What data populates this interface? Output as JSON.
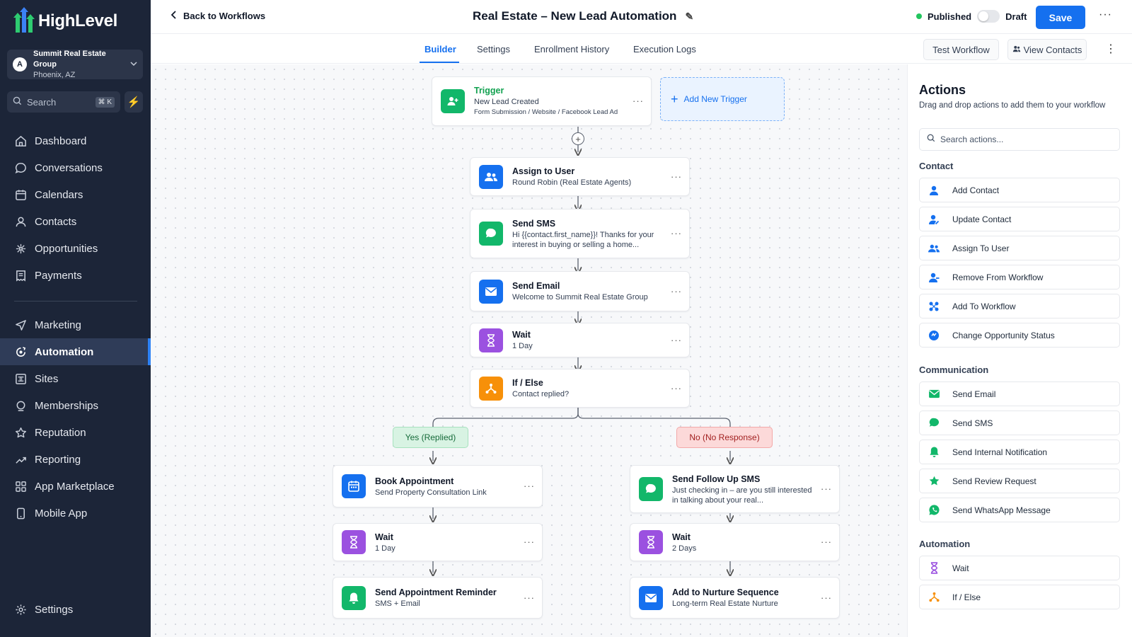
{
  "brand": {
    "name": "HighLevel",
    "colors": [
      "#2ecc71",
      "#3b82f6",
      "#f5b700"
    ]
  },
  "account": {
    "initial": "A",
    "name": "Summit Real Estate Group",
    "location": "Phoenix, AZ"
  },
  "sidebar_search": {
    "label": "Search",
    "shortcut": "⌘ K"
  },
  "nav": {
    "items": [
      {
        "label": "Dashboard",
        "icon": "dashboard-icon"
      },
      {
        "label": "Conversations",
        "icon": "chat-icon"
      },
      {
        "label": "Calendars",
        "icon": "calendar-icon"
      },
      {
        "label": "Contacts",
        "icon": "person-icon"
      },
      {
        "label": "Opportunities",
        "icon": "network-icon"
      },
      {
        "label": "Payments",
        "icon": "receipt-icon"
      }
    ],
    "items2": [
      {
        "label": "Marketing",
        "icon": "send-icon"
      },
      {
        "label": "Automation",
        "icon": "automation-icon",
        "active": true
      },
      {
        "label": "Sites",
        "icon": "sites-icon"
      },
      {
        "label": "Memberships",
        "icon": "membership-icon"
      },
      {
        "label": "Reputation",
        "icon": "star-icon"
      },
      {
        "label": "Reporting",
        "icon": "trend-icon"
      },
      {
        "label": "App Marketplace",
        "icon": "grid-icon"
      },
      {
        "label": "Mobile App",
        "icon": "phone-icon"
      }
    ],
    "settings": "Settings"
  },
  "header": {
    "back": "Back to Workflows",
    "title": "Real Estate – New Lead Automation",
    "published": "Published",
    "draft": "Draft",
    "save": "Save"
  },
  "tabs": [
    {
      "label": "Builder",
      "active": true
    },
    {
      "label": "Settings"
    },
    {
      "label": "Enrollment History"
    },
    {
      "label": "Execution Logs"
    }
  ],
  "tab_buttons": {
    "test": "Test Workflow",
    "view": "View Contacts"
  },
  "workflow": {
    "trigger": {
      "heading": "Trigger",
      "name": "New Lead Created",
      "sources": "Form Submission / Website / Facebook Lead Ad"
    },
    "add_trigger": "Add New Trigger",
    "steps": [
      {
        "title": "Assign to User",
        "sub": "Round Robin (Real Estate Agents)",
        "color": "#1570ef",
        "icon": "users-icon"
      },
      {
        "title": "Send SMS",
        "sub": "Hi {{contact.first_name}}! Thanks for your interest in buying or selling a home...",
        "color": "#12b76a",
        "icon": "sms-icon"
      },
      {
        "title": "Send Email",
        "sub": "Welcome to Summit Real Estate Group",
        "color": "#1570ef",
        "icon": "email-icon"
      },
      {
        "title": "Wait",
        "sub": "1 Day",
        "color": "#9b51e0",
        "icon": "hourglass-icon"
      },
      {
        "title": "If / Else",
        "sub": "Contact replied?",
        "color": "#f79009",
        "icon": "branch-icon"
      }
    ],
    "yes_label": "Yes (Replied)",
    "no_label": "No (No Response)",
    "yes_branch": [
      {
        "title": "Book Appointment",
        "sub": "Send Property Consultation Link",
        "color": "#1570ef",
        "icon": "calendar-icon"
      },
      {
        "title": "Wait",
        "sub": "1 Day",
        "color": "#9b51e0",
        "icon": "hourglass-icon"
      },
      {
        "title": "Send Appointment Reminder",
        "sub": "SMS + Email",
        "color": "#12b76a",
        "icon": "bell-icon"
      }
    ],
    "no_branch": [
      {
        "title": "Send Follow Up SMS",
        "sub": "Just checking in – are you still interested in talking about your real...",
        "color": "#12b76a",
        "icon": "sms-icon"
      },
      {
        "title": "Wait",
        "sub": "2 Days",
        "color": "#9b51e0",
        "icon": "hourglass-icon"
      },
      {
        "title": "Add to Nurture Sequence",
        "sub": "Long-term Real Estate Nurture",
        "color": "#1570ef",
        "icon": "email-icon"
      }
    ]
  },
  "panel": {
    "title": "Actions",
    "subtitle": "Drag and drop actions to add them to your workflow",
    "search_placeholder": "Search actions...",
    "sections": [
      {
        "label": "Contact",
        "items": [
          {
            "label": "Add Contact",
            "icon": "person-icon",
            "color": "#1570ef"
          },
          {
            "label": "Update Contact",
            "icon": "person-edit-icon",
            "color": "#1570ef"
          },
          {
            "label": "Assign To User",
            "icon": "users-icon",
            "color": "#1570ef"
          },
          {
            "label": "Remove From Workflow",
            "icon": "person-remove-icon",
            "color": "#1570ef"
          },
          {
            "label": "Add To Workflow",
            "icon": "workflow-icon",
            "color": "#1570ef"
          },
          {
            "label": "Change Opportunity Status",
            "icon": "status-icon",
            "color": "#1570ef"
          }
        ]
      },
      {
        "label": "Communication",
        "items": [
          {
            "label": "Send Email",
            "icon": "email-icon",
            "color": "#12b76a"
          },
          {
            "label": "Send SMS",
            "icon": "sms-icon",
            "color": "#12b76a"
          },
          {
            "label": "Send Internal Notification",
            "icon": "bell-icon",
            "color": "#12b76a"
          },
          {
            "label": "Send Review Request",
            "icon": "star-icon",
            "color": "#12b76a"
          },
          {
            "label": "Send WhatsApp Message",
            "icon": "whatsapp-icon",
            "color": "#12b76a"
          }
        ]
      },
      {
        "label": "Automation",
        "items": [
          {
            "label": "Wait",
            "icon": "hourglass-icon",
            "color": "#9b51e0"
          },
          {
            "label": "If / Else",
            "icon": "branch-icon",
            "color": "#f79009"
          }
        ]
      }
    ]
  }
}
